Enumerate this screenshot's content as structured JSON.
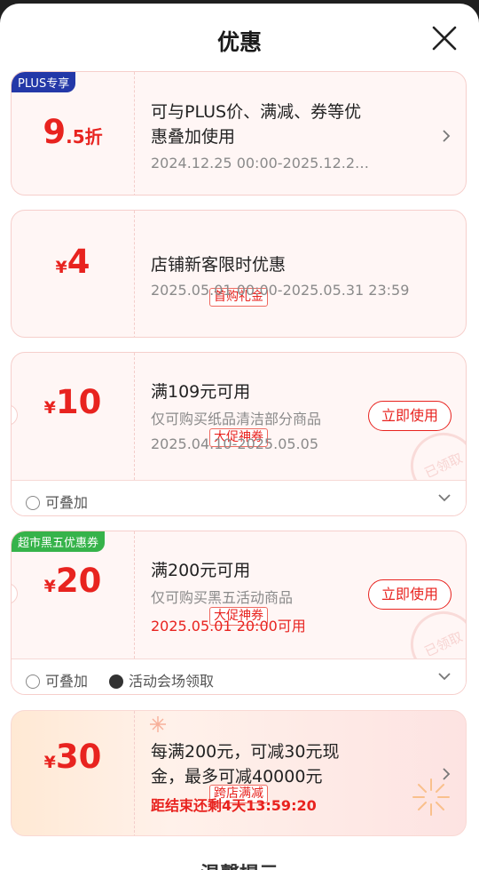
{
  "header": {
    "title": "优惠"
  },
  "colors": {
    "accent": "#e8231f",
    "plus_badge": "#2438a8",
    "green_badge": "#36b34a"
  },
  "coupons": [
    {
      "badge": "PLUS专享",
      "amount_int": "9",
      "amount_suffix": ".5折",
      "line1": "可与PLUS价、满减、券等优",
      "line1b": "惠叠加使用",
      "line2": "2024.12.25 00:00-2025.12.2…"
    },
    {
      "yen": "¥",
      "amount": "4",
      "tag": "首购礼金",
      "line1": "店铺新客限时优惠",
      "line2": "2025.05.01 00:00-2025.05.31 23:59"
    },
    {
      "yen": "¥",
      "amount": "10",
      "tag": "大促神券",
      "line1": "满109元可用",
      "line2": "仅可购买纸品清洁部分商品",
      "line3": "2025.04.10-2025.05.05",
      "button": "立即使用",
      "stamp": "已领取",
      "stackable": "可叠加"
    },
    {
      "badge": "超市黑五优惠券",
      "yen": "¥",
      "amount": "20",
      "tag": "大促神券",
      "line1": "满200元可用",
      "line2": "仅可购买黑五活动商品",
      "line3": "2025.05.01 20:00可用",
      "button": "立即使用",
      "stamp": "已领取",
      "stackable": "可叠加",
      "venue": "活动会场领取"
    },
    {
      "yen": "¥",
      "amount": "30",
      "tag": "跨店满减",
      "line1": "每满200元，可减30元现",
      "line1b": "金，最多可减40000元",
      "countdown": "距结束还剩4天13:59:20"
    }
  ],
  "peek_title": "温馨提示"
}
